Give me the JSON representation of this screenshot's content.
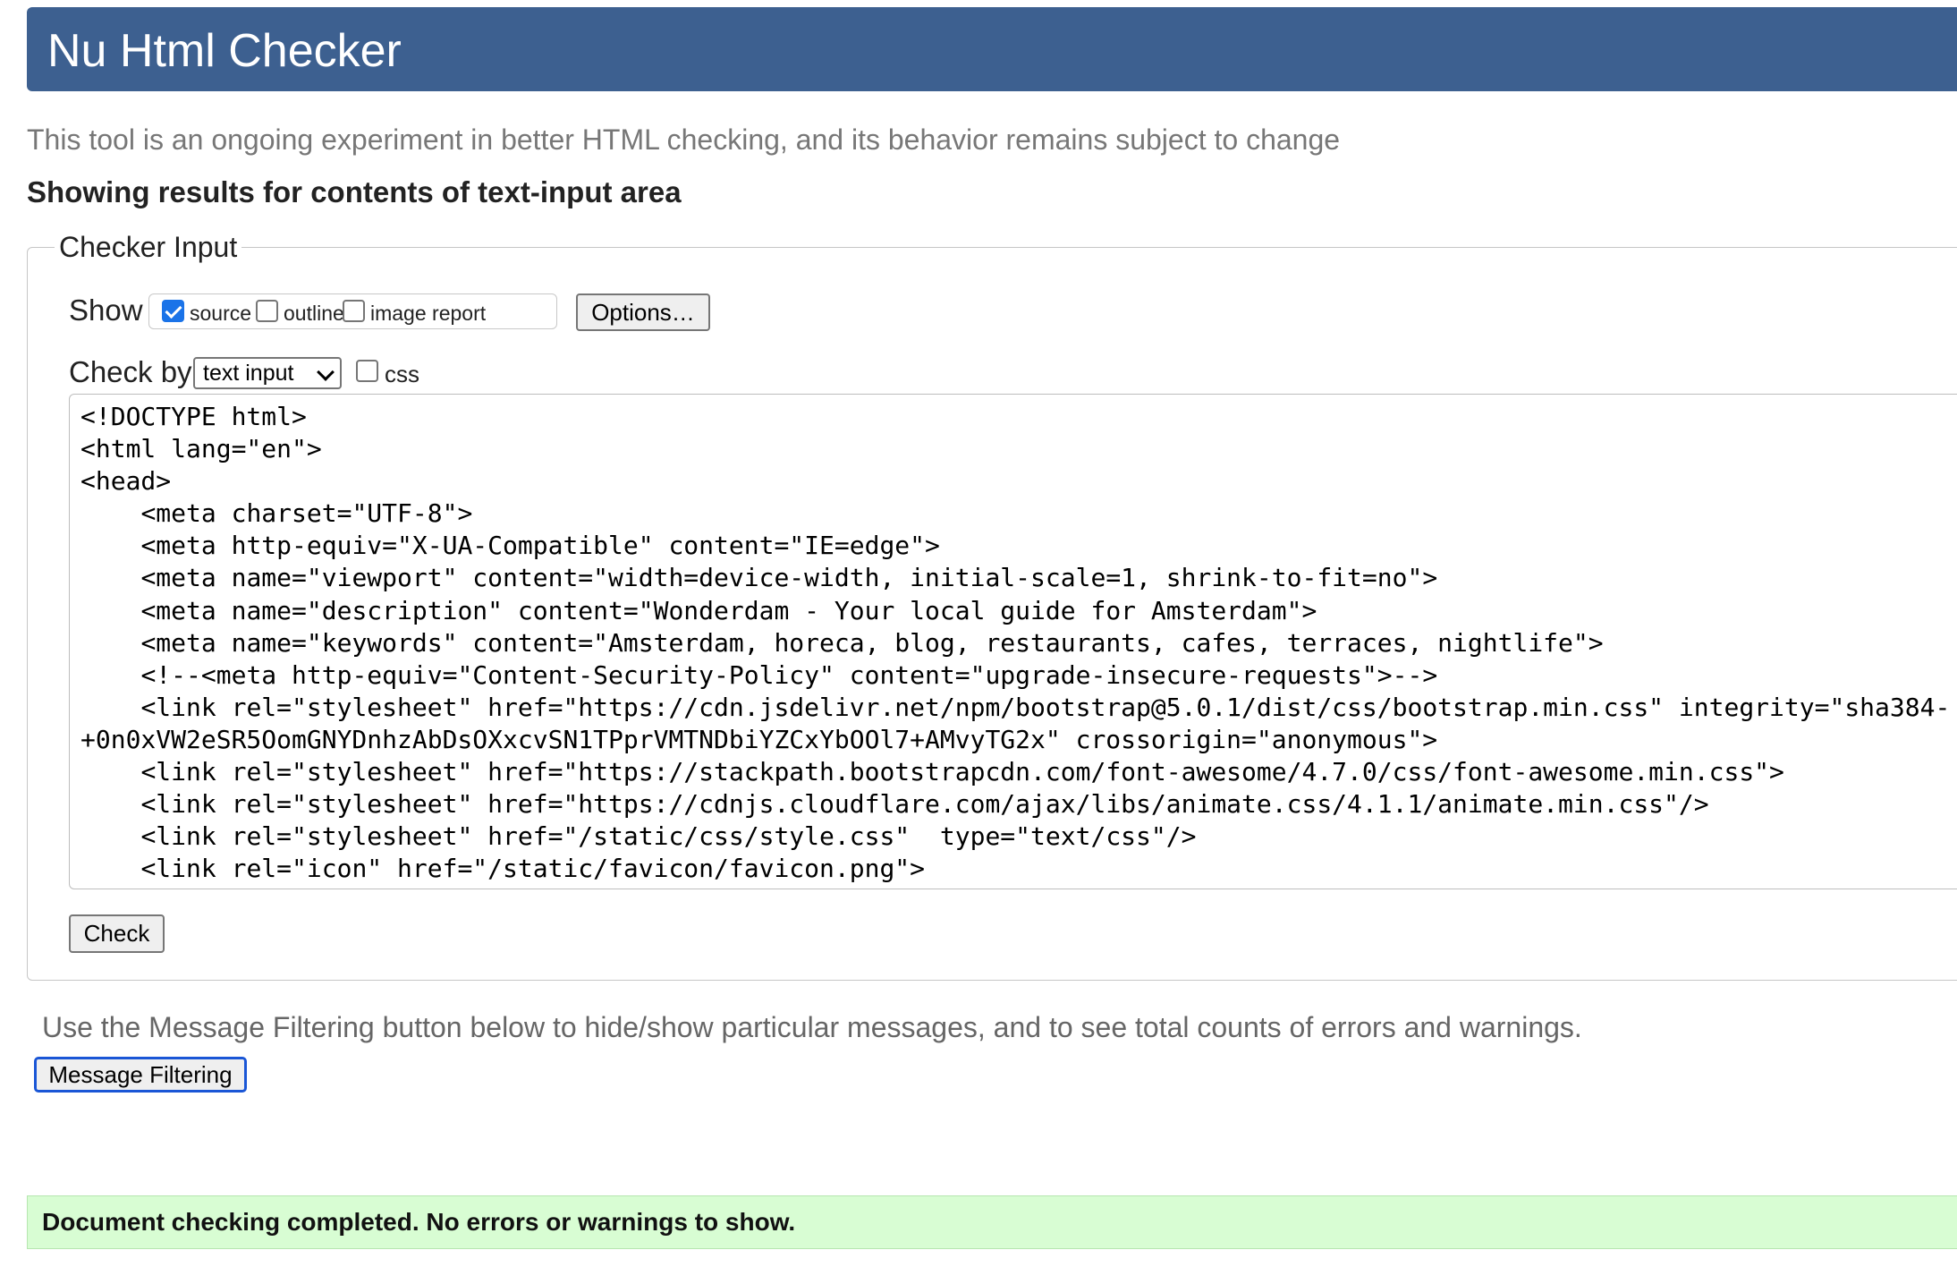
{
  "header": {
    "title": "Nu Html Checker"
  },
  "tagline": "This tool is an ongoing experiment in better HTML checking, and its behavior remains subject to change",
  "results_heading": "Showing results for contents of text-input area",
  "checker_input": {
    "legend": "Checker Input",
    "show_label": "Show",
    "show_options": [
      {
        "label": "source",
        "checked": true
      },
      {
        "label": "outline",
        "checked": false
      },
      {
        "label": "image report",
        "checked": false
      }
    ],
    "options_button": "Options…",
    "check_by_label": "Check by",
    "check_by_selected": "text input",
    "css_label": "css",
    "css_checked": false,
    "source_text": "<!DOCTYPE html>\n<html lang=\"en\">\n<head>\n    <meta charset=\"UTF-8\">\n    <meta http-equiv=\"X-UA-Compatible\" content=\"IE=edge\">\n    <meta name=\"viewport\" content=\"width=device-width, initial-scale=1, shrink-to-fit=no\">\n    <meta name=\"description\" content=\"Wonderdam - Your local guide for Amsterdam\">\n    <meta name=\"keywords\" content=\"Amsterdam, horeca, blog, restaurants, cafes, terraces, nightlife\">\n    <!--<meta http-equiv=\"Content-Security-Policy\" content=\"upgrade-insecure-requests\">-->\n    <link rel=\"stylesheet\" href=\"https://cdn.jsdelivr.net/npm/bootstrap@5.0.1/dist/css/bootstrap.min.css\" integrity=\"sha384-\n+0n0xVW2eSR5OomGNYDnhzAbDsOXxcvSN1TPprVMTNDbiYZCxYbOOl7+AMvyTG2x\" crossorigin=\"anonymous\">\n    <link rel=\"stylesheet\" href=\"https://stackpath.bootstrapcdn.com/font-awesome/4.7.0/css/font-awesome.min.css\">\n    <link rel=\"stylesheet\" href=\"https://cdnjs.cloudflare.com/ajax/libs/animate.css/4.1.1/animate.min.css\"/>\n    <link rel=\"stylesheet\" href=\"/static/css/style.css\"  type=\"text/css\"/>\n    <link rel=\"icon\" href=\"/static/favicon/favicon.png\">",
    "check_button": "Check"
  },
  "filter_note": "Use the Message Filtering button below to hide/show particular messages, and to see total counts of errors and warnings.",
  "filter_button": "Message Filtering",
  "status_message": "Document checking completed. No errors or warnings to show.",
  "colors": {
    "header_bg": "#3d6090",
    "success_bg": "#d8fdd3",
    "checkbox_accent": "#1a73e8",
    "focus_ring": "#1a56d6"
  }
}
